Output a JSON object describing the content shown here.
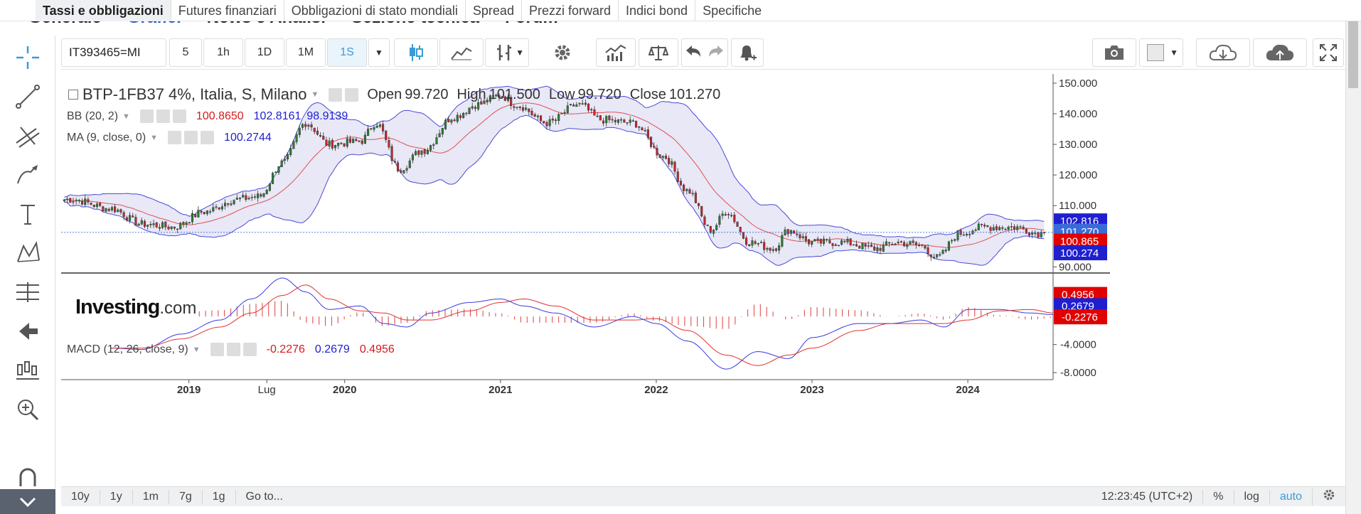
{
  "nav": {
    "tabs": [
      "Tassi e obbligazioni",
      "Futures finanziari",
      "Obbligazioni di stato mondiali",
      "Spread",
      "Prezzi forward",
      "Indici bond",
      "Specifiche"
    ],
    "sub": [
      "Generale",
      "Grafici",
      "News e Analisi",
      "Sezione tecnica",
      "Forum"
    ]
  },
  "toolbar": {
    "symbol": "IT393465=MI",
    "intervals": [
      "5",
      "1h",
      "1D",
      "1M",
      "1S"
    ],
    "active_interval": "1S"
  },
  "icons": {
    "left": [
      "crosshair-icon",
      "trendline-icon",
      "fib-icon",
      "brush-icon",
      "text-icon",
      "pattern-icon",
      "gann-icon",
      "back-arrow-icon",
      "measure-icon",
      "zoom-icon",
      "magnet-icon"
    ],
    "top": [
      "candles-icon",
      "line-chart-icon",
      "bars-icon",
      "settings-icon",
      "indicators-icon",
      "compare-icon",
      "undo-icon",
      "redo-icon",
      "alert-icon",
      "camera-icon",
      "color-icon",
      "cloud-download-icon",
      "cloud-upload-icon",
      "fullscreen-icon"
    ]
  },
  "legend": {
    "title": "BTP-1FB37 4%, Italia, S, Milano",
    "open_label": "Open",
    "open": "99.720",
    "high_label": "High",
    "high": "101.500",
    "low_label": "Low",
    "low": "99.720",
    "close_label": "Close",
    "close": "101.270",
    "bb_label": "BB (20, 2)",
    "bb_mid": "100.8650",
    "bb_up": "102.8161",
    "bb_low": "98.9139",
    "ma_label": "MA (9, close, 0)",
    "ma": "100.2744",
    "macd_label": "MACD (12, 26, close, 9)",
    "macd_hist": "-0.2276",
    "macd_line": "0.2679",
    "macd_signal": "0.4956"
  },
  "brand": {
    "main": "Investing",
    "suffix": ".com"
  },
  "colors": {
    "up": "#2e7d32",
    "down": "#c62828",
    "bb": "#4a4ad8",
    "ma": "#e05050",
    "band_fill": "#e6e6f6",
    "accent": "#3a9bd5"
  },
  "chart_data": {
    "type": "candlestick",
    "title": "BTP-1FB37 4%, Italia, S, Milano",
    "interval": "weekly",
    "y_ticks": [
      "150.000",
      "140.000",
      "130.000",
      "120.000",
      "110.000",
      "90.000"
    ],
    "ylim": [
      88,
      153
    ],
    "x_ticks": [
      "2019",
      "Lug",
      "2020",
      "2021",
      "2022",
      "2023",
      "2024"
    ],
    "price_anchors": {
      "x": [
        2018.25,
        2018.5,
        2018.7,
        2018.9,
        2019.1,
        2019.3,
        2019.45,
        2019.6,
        2019.75,
        2019.9,
        2020.1,
        2020.2,
        2020.35,
        2020.5,
        2020.7,
        2020.85,
        2021.0,
        2021.1,
        2021.3,
        2021.5,
        2021.65,
        2021.85,
        2022.05,
        2022.2,
        2022.35,
        2022.45,
        2022.6,
        2022.75,
        2022.85,
        2023.0,
        2023.2,
        2023.4,
        2023.55,
        2023.7,
        2023.8,
        2023.95,
        2024.1,
        2024.3,
        2024.45
      ],
      "y": [
        112,
        109,
        104,
        103,
        108,
        112,
        113,
        124,
        137,
        130,
        131,
        137,
        122,
        128,
        139,
        143,
        146,
        143,
        137,
        143,
        138,
        137,
        126,
        115,
        102,
        108,
        98,
        96,
        102,
        98,
        98,
        96,
        98,
        97,
        93,
        101,
        103,
        103,
        101
      ]
    },
    "bb_upper_last": 102.8161,
    "bb_mid_last": 100.865,
    "bb_lower_last": 98.9139,
    "ma_last": 100.2744,
    "close_last": 101.27,
    "macd": {
      "y_ticks": [
        "-4.0000",
        "-8.0000"
      ],
      "ylim": [
        -9,
        6
      ],
      "anchors_x": [
        2018.5,
        2018.7,
        2018.95,
        2019.2,
        2019.4,
        2019.6,
        2019.75,
        2019.9,
        2020.1,
        2020.25,
        2020.4,
        2020.55,
        2020.8,
        2021.0,
        2021.15,
        2021.35,
        2021.6,
        2021.85,
        2022.0,
        2022.2,
        2022.45,
        2022.65,
        2022.85,
        2023.0,
        2023.3,
        2023.5,
        2023.7,
        2023.85,
        2024.0,
        2024.2,
        2024.4,
        2024.55
      ],
      "macd_line": [
        -4.5,
        -4.7,
        -2.5,
        -0.5,
        2.5,
        5.5,
        3.5,
        1.0,
        1.5,
        -1.0,
        -1.5,
        0.5,
        2.0,
        2.5,
        1.5,
        0.5,
        -1.5,
        0.0,
        -1.0,
        -3.5,
        -7.5,
        -5.0,
        -6.0,
        -3.0,
        -1.0,
        -1.0,
        -0.5,
        -1.5,
        1.0,
        1.0,
        0.5,
        0.27
      ],
      "signal_line": [
        -4.5,
        -4.5,
        -3.2,
        -1.5,
        0.5,
        3.0,
        4.5,
        2.5,
        0.8,
        0.5,
        -0.5,
        -0.5,
        0.8,
        2.0,
        2.5,
        1.5,
        -0.5,
        -0.5,
        -0.3,
        -2.0,
        -5.5,
        -7.0,
        -5.5,
        -4.5,
        -2.0,
        -1.0,
        -1.0,
        -1.0,
        -0.5,
        0.8,
        1.0,
        0.5
      ],
      "last": {
        "hist": -0.2276,
        "macd": 0.2679,
        "signal": 0.4956
      }
    }
  },
  "axis": {
    "price_labels": [
      "150.000",
      "140.000",
      "130.000",
      "120.000",
      "110.000",
      "90.000"
    ],
    "badges": [
      "102.816",
      "101.270",
      "100.865",
      "100.274"
    ],
    "macd_labels": [
      "-4.0000",
      "-8.0000"
    ],
    "macd_badges": [
      "0.4956",
      "0.2679",
      "-0.2276"
    ]
  },
  "bottombar": {
    "ranges": [
      "10y",
      "1y",
      "1m",
      "7g",
      "1g"
    ],
    "goto": "Go to...",
    "time": "12:23:45 (UTC+2)",
    "opts": [
      "%",
      "log",
      "auto"
    ]
  }
}
